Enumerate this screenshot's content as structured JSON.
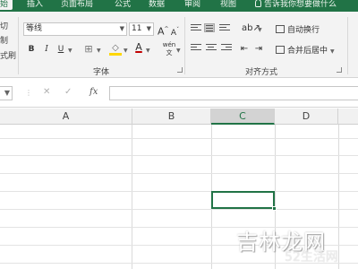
{
  "ribbon_tabs": {
    "home": "始",
    "insert": "插入",
    "layout": "页面布局",
    "formulas": "公式",
    "data": "数据",
    "review": "审阅",
    "view": "视图",
    "tell_me": "告诉我你想要做什么"
  },
  "clipboard": {
    "cut_fragment": "切",
    "copy_fragment": "制",
    "format_fragment": "式刷"
  },
  "font": {
    "family_value": "等线",
    "size_value": "11",
    "grow_label": "A",
    "shrink_label": "A",
    "bold_label": "B",
    "italic_label": "I",
    "underline_label": "U",
    "phonetic_label": "wén",
    "font_color_label": "A",
    "group_label": "字体",
    "fill_color": "#ffd700",
    "text_color": "#c00000"
  },
  "alignment": {
    "wrap_text_label": "自动换行",
    "merge_center_label": "合并后居中",
    "group_label": "对齐方式"
  },
  "formula_bar": {
    "cancel_label": "✕",
    "enter_label": "✓",
    "fx_label": "fx",
    "value": ""
  },
  "grid": {
    "columns": [
      "A",
      "B",
      "C",
      "D"
    ],
    "selected_column": "C",
    "accent": "#217346"
  },
  "watermark": {
    "main": "吉林龙网",
    "sub": "52生活网"
  }
}
